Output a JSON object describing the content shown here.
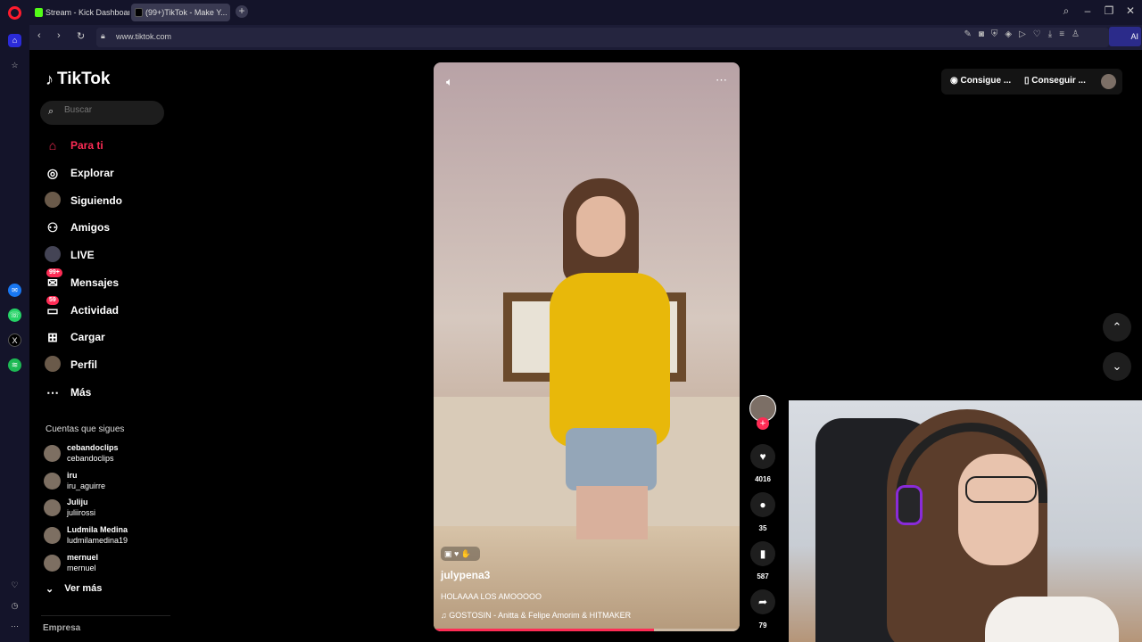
{
  "browser": {
    "tabs": [
      {
        "label": "Stream - Kick Dashboard"
      },
      {
        "label": "(99+)TikTok - Make Y..."
      }
    ],
    "url": "www.tiktok.com",
    "ai_label": "AI"
  },
  "tiktok": {
    "logo": "TikTok",
    "search_placeholder": "Buscar",
    "nav": [
      {
        "label": "Para ti"
      },
      {
        "label": "Explorar"
      },
      {
        "label": "Siguiendo"
      },
      {
        "label": "Amigos"
      },
      {
        "label": "LIVE"
      },
      {
        "label": "Mensajes",
        "badge": "99+"
      },
      {
        "label": "Actividad",
        "badge": "59"
      },
      {
        "label": "Cargar"
      },
      {
        "label": "Perfil"
      },
      {
        "label": "Más"
      }
    ],
    "following_title": "Cuentas que sigues",
    "following": [
      {
        "name": "cebandoclips",
        "handle": "cebandoclips"
      },
      {
        "name": "iru",
        "handle": "iru_aguirre"
      },
      {
        "name": "Juliju",
        "handle": "juliirossi"
      },
      {
        "name": "Ludmila Medina",
        "handle": "ludmilamedina19"
      },
      {
        "name": "mernuel",
        "handle": "mernuel"
      }
    ],
    "see_more": "Ver más",
    "footer": "Empresa",
    "top_buttons": {
      "coins": "Consigue ...",
      "app": "Conseguir ..."
    },
    "video": {
      "username": "julypena3",
      "description": "HOLAAAA LOS AMOOOOO",
      "music": "GOSTOSIN - Anitta & Felipe Amorim & HITMAKER",
      "progress": 0.72,
      "likes": "4016",
      "comments": "35",
      "saves": "587",
      "shares": "79"
    }
  }
}
